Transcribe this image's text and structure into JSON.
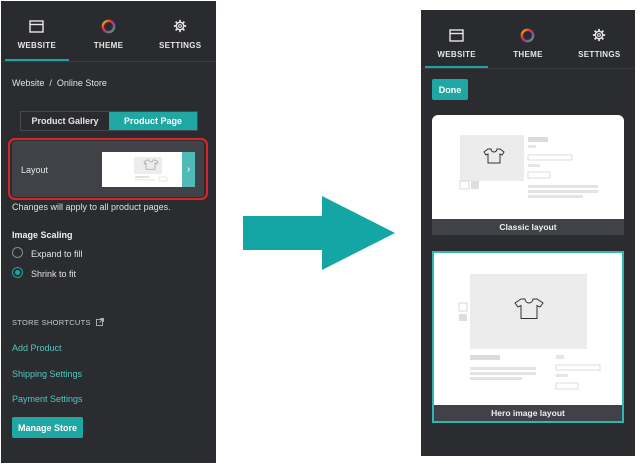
{
  "nav": {
    "website": "WEBSITE",
    "theme": "THEME",
    "settings": "SETTINGS"
  },
  "left_panel": {
    "breadcrumb_root": "Website",
    "breadcrumb_sep": "/",
    "breadcrumb_current": "Online Store",
    "tabs": {
      "gallery": "Product Gallery",
      "page": "Product Page"
    },
    "layout_label": "Layout",
    "layout_note": "Changes will apply to all product pages.",
    "scaling_title": "Image Scaling",
    "scaling_options": [
      {
        "label": "Expand to fill",
        "selected": false
      },
      {
        "label": "Shrink to fit",
        "selected": true
      }
    ],
    "shortcuts_title": "STORE SHORTCUTS",
    "links": [
      "Add Product",
      "Shipping Settings",
      "Payment Settings"
    ],
    "manage_button": "Manage Store"
  },
  "right_panel": {
    "done_button": "Done",
    "layouts": [
      {
        "caption": "Classic layout",
        "selected": false
      },
      {
        "caption": "Hero image layout",
        "selected": true
      }
    ]
  },
  "colors": {
    "panel_bg": "#2b2c2f",
    "accent_teal": "#1ea7a3",
    "link_teal": "#52c6c1",
    "highlight_red": "#d9262b",
    "arrow_teal": "#13a6a5"
  },
  "icons": [
    "browser-window-icon",
    "color-wheel-icon",
    "gear-icon",
    "external-link-icon",
    "chevron-right-icon",
    "tshirt-icon"
  ]
}
